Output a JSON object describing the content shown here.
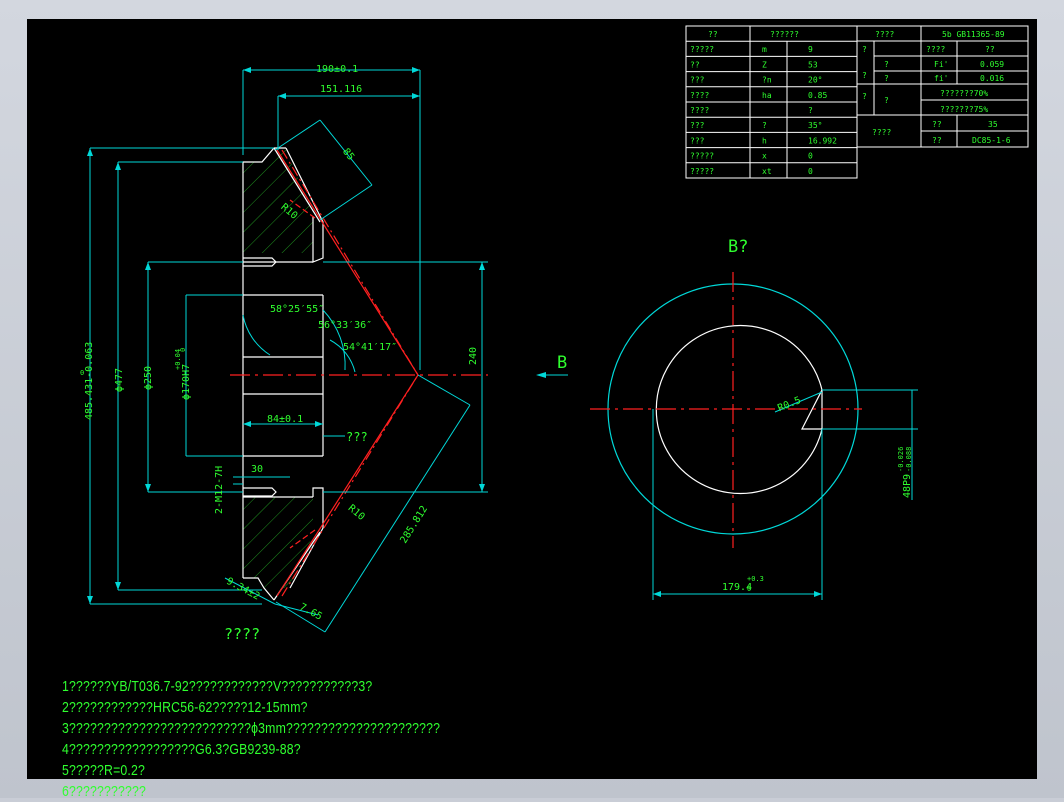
{
  "colors": {
    "background": "#000000",
    "frame": "#c9cdd6",
    "dimension": "#00d8d8",
    "outline": "#ffffff",
    "hatch": "#1f8f1f",
    "text": "#2fff2f",
    "center": "#ff2020"
  },
  "table_left": [
    [
      "??",
      "??????",
      ""
    ],
    [
      "?????",
      "m",
      "9"
    ],
    [
      "??",
      "Z",
      "53"
    ],
    [
      "???",
      "?n",
      "20°"
    ],
    [
      "????",
      "ha",
      "0.85"
    ],
    [
      "????",
      "",
      "?"
    ],
    [
      "???",
      "?",
      "35°"
    ],
    [
      "???",
      "h",
      "16.992"
    ],
    [
      "?????",
      "x",
      "0"
    ],
    [
      "?????",
      "xt",
      "0"
    ]
  ],
  "table_right": {
    "header": [
      "????",
      "5b  GB11365-89"
    ],
    "rows": [
      [
        "?",
        "",
        "????",
        "??"
      ],
      [
        "?",
        "?",
        "Fi'",
        "0.059"
      ],
      [
        "?",
        "?",
        "fi'",
        "0.016"
      ],
      [
        "?",
        "?",
        "???????70%",
        ""
      ],
      [
        "",
        "",
        "???????75%",
        ""
      ],
      [
        "????",
        "??",
        "35",
        ""
      ],
      [
        "",
        "??",
        "DC85-1-6",
        ""
      ]
    ]
  },
  "dims": {
    "d190": "190±0.1",
    "d151": "151.116",
    "d85": "85",
    "r10a": "R10",
    "ang1": "58°25′55″",
    "ang2": "56°33′36″",
    "ang3": "54°41′17″",
    "d485": "485.431-0.063",
    "d485sup": "0",
    "phi477": "ϕ477",
    "phi250": "ϕ250",
    "phi170": "ϕ170H7",
    "phi170tol": "+0.04",
    "phi170tol0": "0",
    "d84": "84±0.1",
    "qmarks": "???",
    "d240": "240",
    "d30": "30",
    "m12": "2-M12-7H",
    "r10b": "R10",
    "d285": "285.812",
    "d934": "9.34±2",
    "d765": "7.65",
    "section_label": "????",
    "b_label": "B",
    "view_label": "B?",
    "r05": "R0.5",
    "d1794": "179.4",
    "d1794tol": "+0.3",
    "d1794tol0": "0",
    "d48": "48P9",
    "d48tol": "-0.026",
    "d48tol2": "-0.088"
  },
  "notes": [
    "1??????YB/T036.7-92????????????V???????????3?",
    "2????????????HRC56-62?????12-15mm?",
    "3??????????????????????????ϕ3mm??????????????????????",
    "4??????????????????G6.3?GB9239-88?",
    "5?????R=0.2?",
    "6???????????"
  ]
}
